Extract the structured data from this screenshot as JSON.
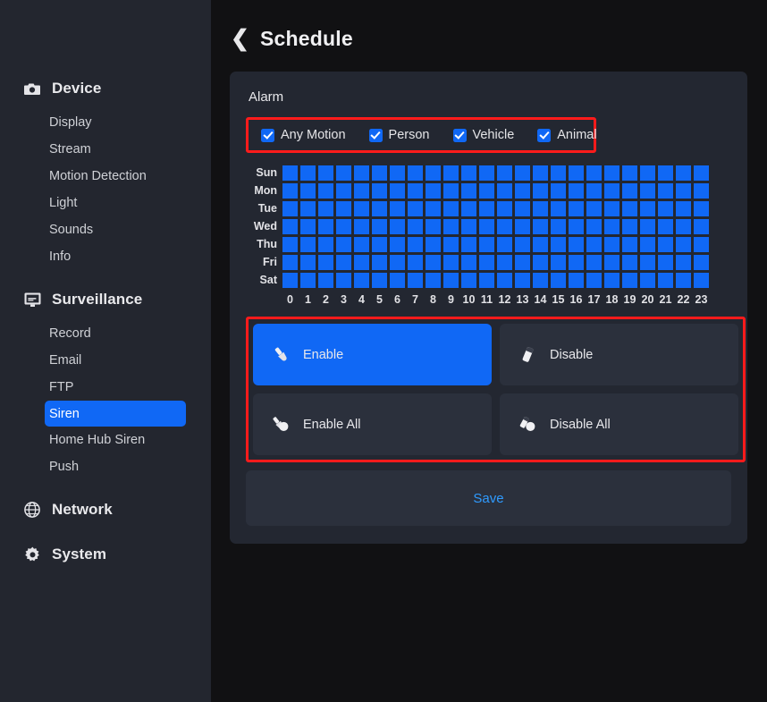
{
  "colors": {
    "accent": "#1068f5",
    "highlight_box": "#ff1b1b",
    "card_bg": "#232731",
    "sidebar_bg": "#23262f",
    "page_bg": "#111113",
    "button_bg": "#2b303c",
    "save_text": "#2f9bff",
    "grid_on": "#1068f5"
  },
  "sidebar": {
    "groups": [
      {
        "label": "Device",
        "icon": "camera-icon",
        "items": [
          {
            "label": "Display",
            "active": false
          },
          {
            "label": "Stream",
            "active": false
          },
          {
            "label": "Motion Detection",
            "active": false
          },
          {
            "label": "Light",
            "active": false
          },
          {
            "label": "Sounds",
            "active": false
          },
          {
            "label": "Info",
            "active": false
          }
        ]
      },
      {
        "label": "Surveillance",
        "icon": "monitor-icon",
        "items": [
          {
            "label": "Record",
            "active": false
          },
          {
            "label": "Email",
            "active": false
          },
          {
            "label": "FTP",
            "active": false
          },
          {
            "label": "Siren",
            "active": true
          },
          {
            "label": "Home Hub Siren",
            "active": false
          },
          {
            "label": "Push",
            "active": false
          }
        ]
      },
      {
        "label": "Network",
        "icon": "globe-icon",
        "items": []
      },
      {
        "label": "System",
        "icon": "gear-icon",
        "items": []
      }
    ]
  },
  "header": {
    "back_icon": "chevron-left-icon",
    "title": "Schedule"
  },
  "card": {
    "title": "Alarm",
    "alarm_types": [
      {
        "label": "Any Motion",
        "checked": true
      },
      {
        "label": "Person",
        "checked": true
      },
      {
        "label": "Vehicle",
        "checked": true
      },
      {
        "label": "Animal",
        "checked": true
      }
    ],
    "schedule": {
      "days": [
        "Sun",
        "Mon",
        "Tue",
        "Wed",
        "Thu",
        "Fri",
        "Sat"
      ],
      "hours": [
        "0",
        "1",
        "2",
        "3",
        "4",
        "5",
        "6",
        "7",
        "8",
        "9",
        "10",
        "11",
        "12",
        "13",
        "14",
        "15",
        "16",
        "17",
        "18",
        "19",
        "20",
        "21",
        "22",
        "23"
      ],
      "cells": [
        [
          1,
          1,
          1,
          1,
          1,
          1,
          1,
          1,
          1,
          1,
          1,
          1,
          1,
          1,
          1,
          1,
          1,
          1,
          1,
          1,
          1,
          1,
          1,
          1
        ],
        [
          1,
          1,
          1,
          1,
          1,
          1,
          1,
          1,
          1,
          1,
          1,
          1,
          1,
          1,
          1,
          1,
          1,
          1,
          1,
          1,
          1,
          1,
          1,
          1
        ],
        [
          1,
          1,
          1,
          1,
          1,
          1,
          1,
          1,
          1,
          1,
          1,
          1,
          1,
          1,
          1,
          1,
          1,
          1,
          1,
          1,
          1,
          1,
          1,
          1
        ],
        [
          1,
          1,
          1,
          1,
          1,
          1,
          1,
          1,
          1,
          1,
          1,
          1,
          1,
          1,
          1,
          1,
          1,
          1,
          1,
          1,
          1,
          1,
          1,
          1
        ],
        [
          1,
          1,
          1,
          1,
          1,
          1,
          1,
          1,
          1,
          1,
          1,
          1,
          1,
          1,
          1,
          1,
          1,
          1,
          1,
          1,
          1,
          1,
          1,
          1
        ],
        [
          1,
          1,
          1,
          1,
          1,
          1,
          1,
          1,
          1,
          1,
          1,
          1,
          1,
          1,
          1,
          1,
          1,
          1,
          1,
          1,
          1,
          1,
          1,
          1
        ],
        [
          1,
          1,
          1,
          1,
          1,
          1,
          1,
          1,
          1,
          1,
          1,
          1,
          1,
          1,
          1,
          1,
          1,
          1,
          1,
          1,
          1,
          1,
          1,
          1
        ]
      ]
    },
    "actions": [
      {
        "label": "Enable",
        "icon": "paintbrush-icon",
        "selected": true
      },
      {
        "label": "Disable",
        "icon": "eraser-icon",
        "selected": false
      },
      {
        "label": "Enable All",
        "icon": "paintbrush-fill-icon",
        "selected": false
      },
      {
        "label": "Disable All",
        "icon": "eraser-fill-icon",
        "selected": false
      }
    ],
    "save_label": "Save"
  }
}
